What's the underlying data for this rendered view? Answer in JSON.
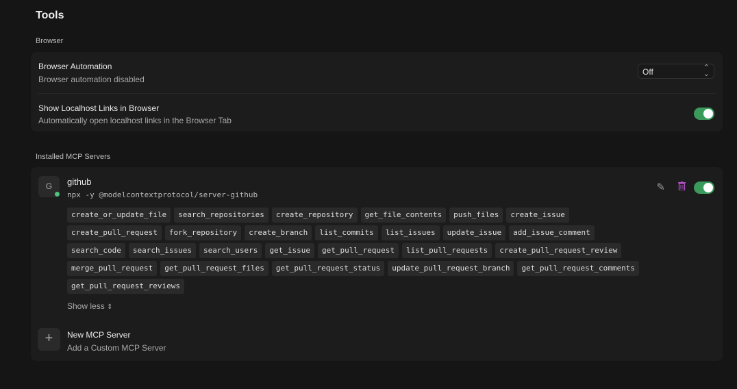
{
  "title": "Tools",
  "browser_section": "Browser",
  "browser_automation": {
    "title": "Browser Automation",
    "subtitle": "Browser automation disabled",
    "value": "Off"
  },
  "localhost_links": {
    "title": "Show Localhost Links in Browser",
    "subtitle": "Automatically open localhost links in the Browser Tab",
    "enabled": true
  },
  "mcp_section": "Installed MCP Servers",
  "server": {
    "avatar": "G",
    "name": "github",
    "command": "npx -y @modelcontextprotocol/server-github",
    "enabled": true,
    "tool_rows": [
      [
        "create_or_update_file",
        "search_repositories",
        "create_repository",
        "get_file_contents",
        "push_files",
        "create_issue"
      ],
      [
        "create_pull_request",
        "fork_repository",
        "create_branch",
        "list_commits",
        "list_issues",
        "update_issue",
        "add_issue_comment"
      ],
      [
        "search_code",
        "search_issues",
        "search_users",
        "get_issue",
        "get_pull_request",
        "list_pull_requests",
        "create_pull_request_review"
      ],
      [
        "merge_pull_request",
        "get_pull_request_files",
        "get_pull_request_status",
        "update_pull_request_branch",
        "get_pull_request_comments"
      ],
      [
        "get_pull_request_reviews"
      ]
    ],
    "show_less": "Show less"
  },
  "new_server": {
    "title": "New MCP Server",
    "subtitle": "Add a Custom MCP Server"
  },
  "colors": {
    "toggle_on": "#3a9a5c",
    "trash": "#b04fc4",
    "status": "#4ec27a"
  }
}
